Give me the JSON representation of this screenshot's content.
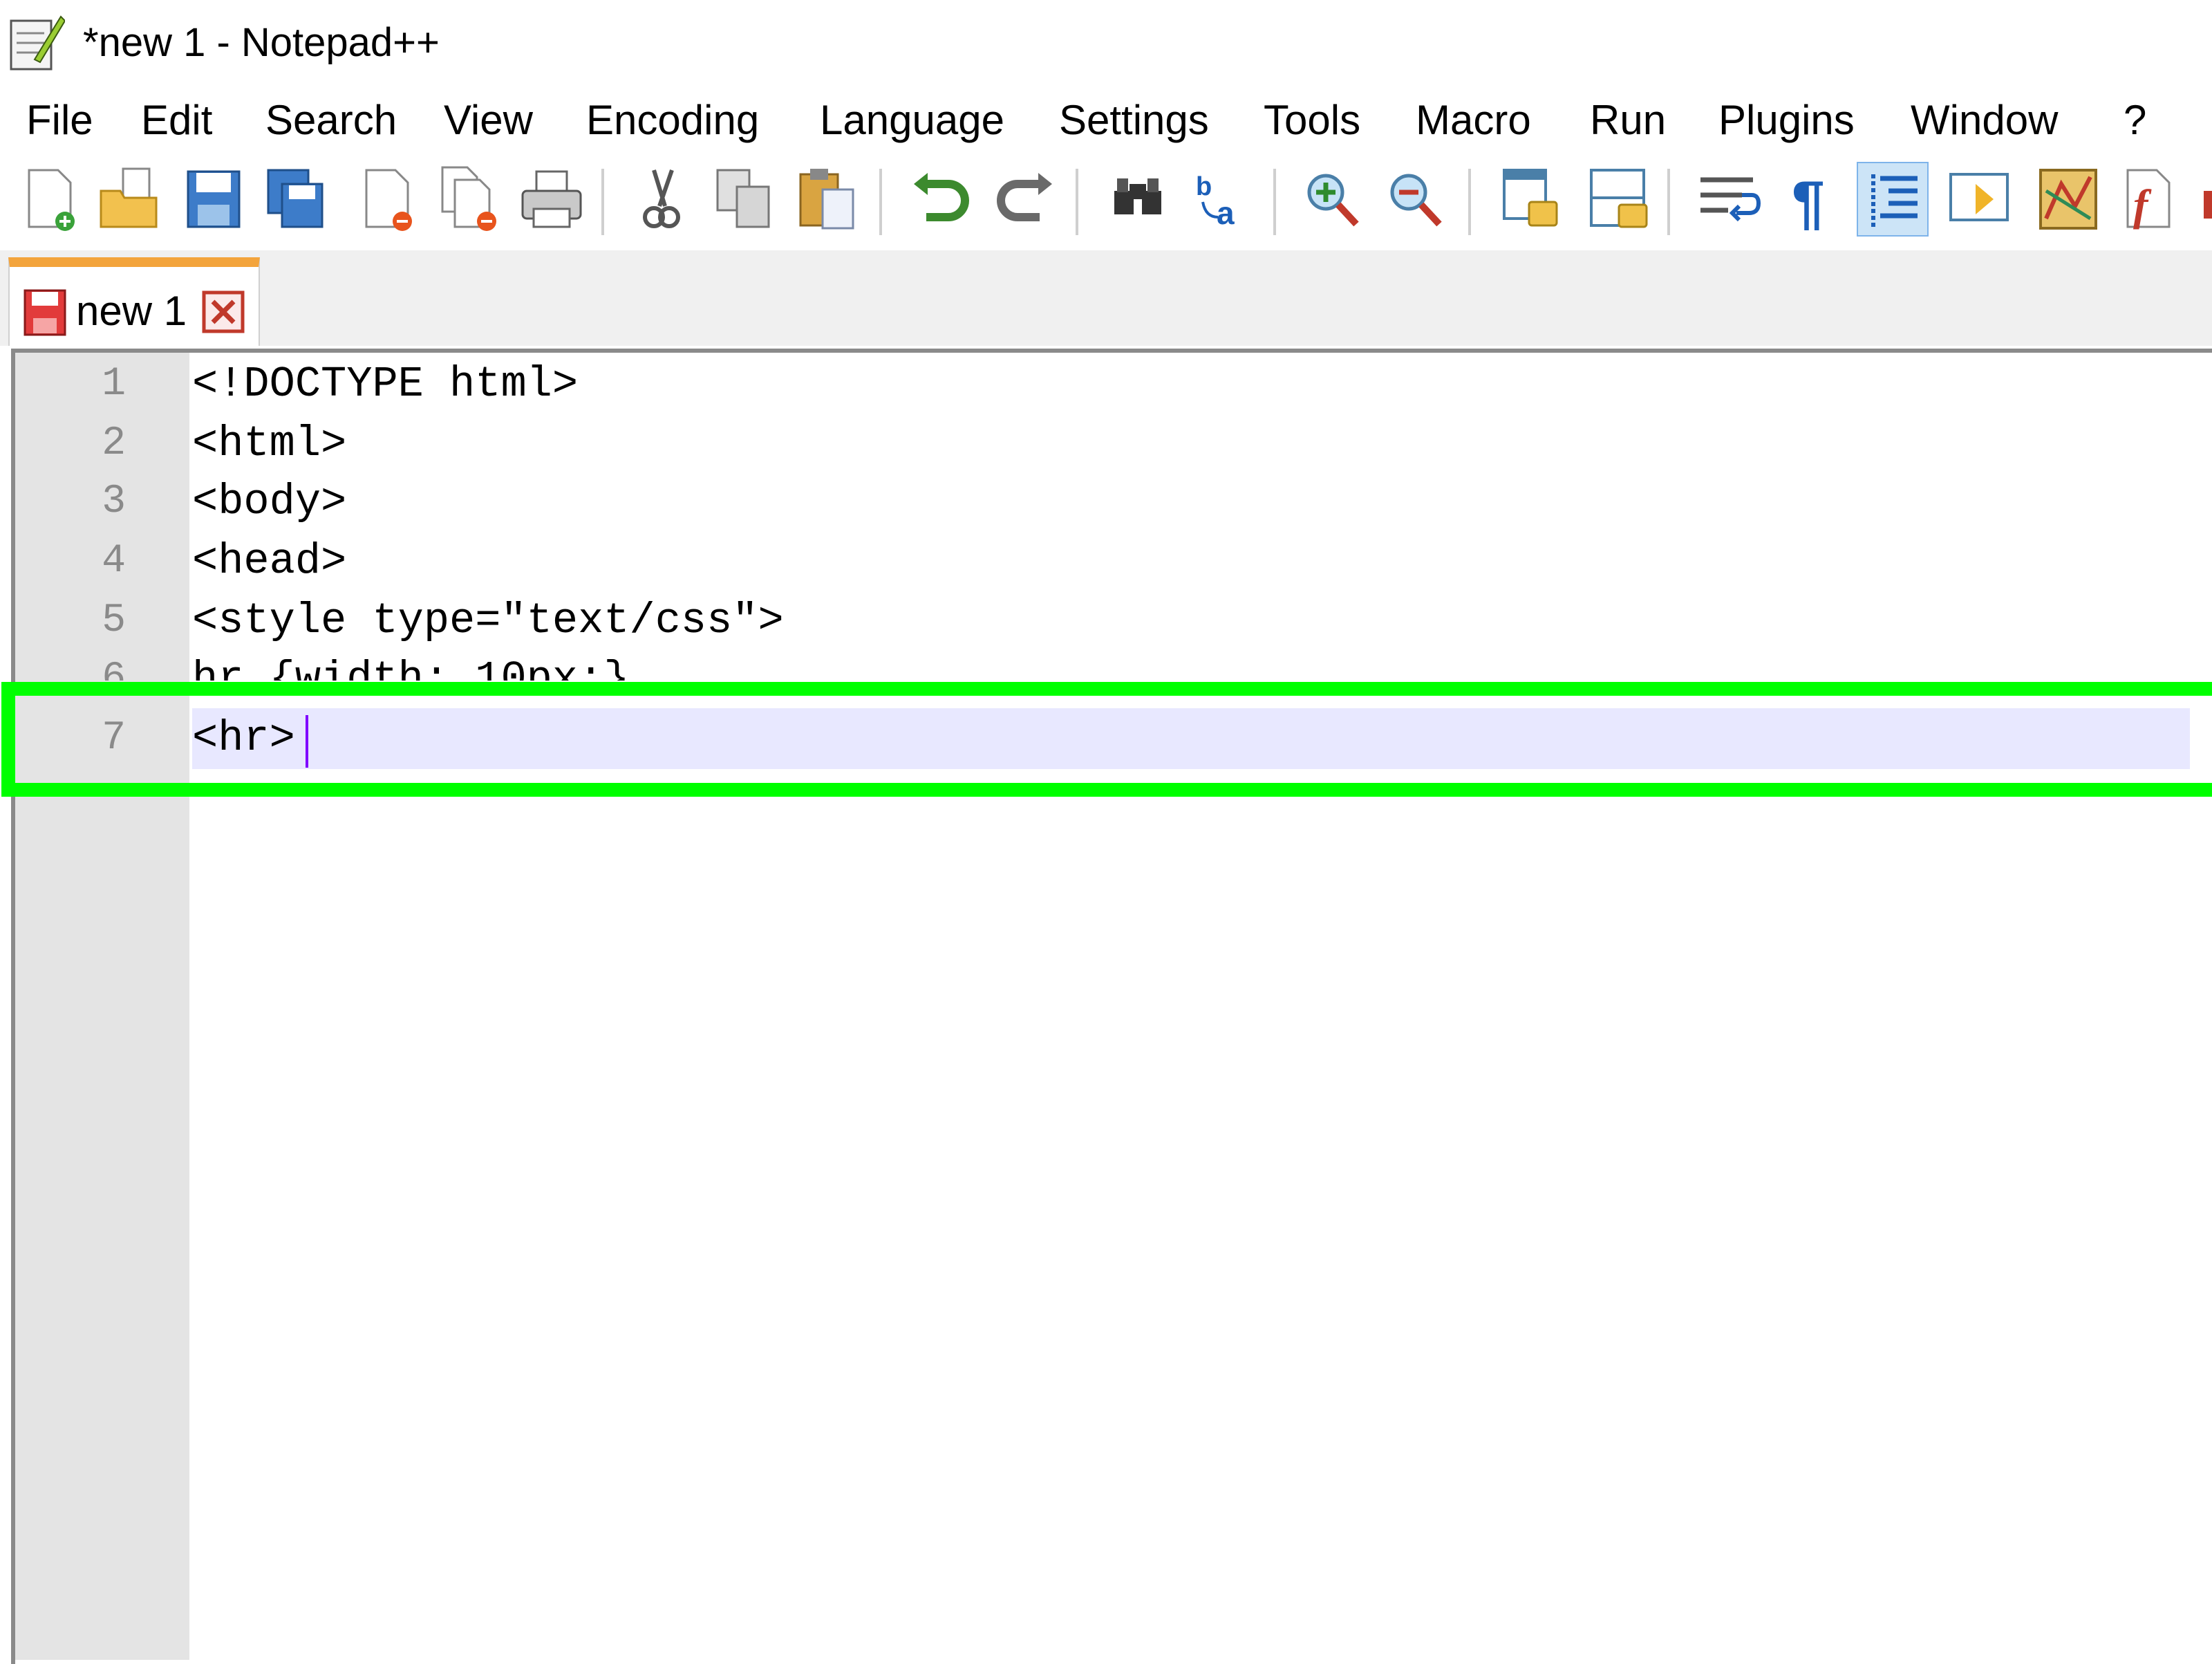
{
  "window": {
    "title": "*new 1 - Notepad++"
  },
  "menu": [
    "File",
    "Edit",
    "Search",
    "View",
    "Encoding",
    "Language",
    "Settings",
    "Tools",
    "Macro",
    "Run",
    "Plugins",
    "Window",
    "?"
  ],
  "toolbar": {
    "icons": [
      "new-file-icon",
      "open-file-icon",
      "save-icon",
      "save-all-icon",
      "close-icon",
      "close-all-icon",
      "print-icon",
      "cut-icon",
      "copy-icon",
      "paste-icon",
      "undo-icon",
      "redo-icon",
      "find-icon",
      "replace-icon",
      "zoom-in-icon",
      "zoom-out-icon",
      "sync-vertical-icon",
      "sync-horizontal-icon",
      "word-wrap-icon",
      "show-all-characters-icon",
      "indent-guide-icon",
      "user-defined-language-icon",
      "document-map-icon",
      "function-list-icon"
    ]
  },
  "tabs": [
    {
      "label": "new 1",
      "modified": true
    }
  ],
  "editor": {
    "lines": [
      {
        "number": "1",
        "text": "<!DOCTYPE html>"
      },
      {
        "number": "2",
        "text": "<html>"
      },
      {
        "number": "3",
        "text": "<body>"
      },
      {
        "number": "4",
        "text": "<head>"
      },
      {
        "number": "5",
        "text": "<style type=\"text/css\">"
      },
      {
        "number": "6",
        "text": "hr {width: 10px;}"
      },
      {
        "number": "7",
        "text": "<hr>"
      }
    ],
    "current_line": 7
  },
  "colors": {
    "highlight_box": "#00ff00",
    "current_line_bg": "#e8e8ff",
    "tab_accent": "#f3a43c",
    "caret": "#8000ff"
  }
}
